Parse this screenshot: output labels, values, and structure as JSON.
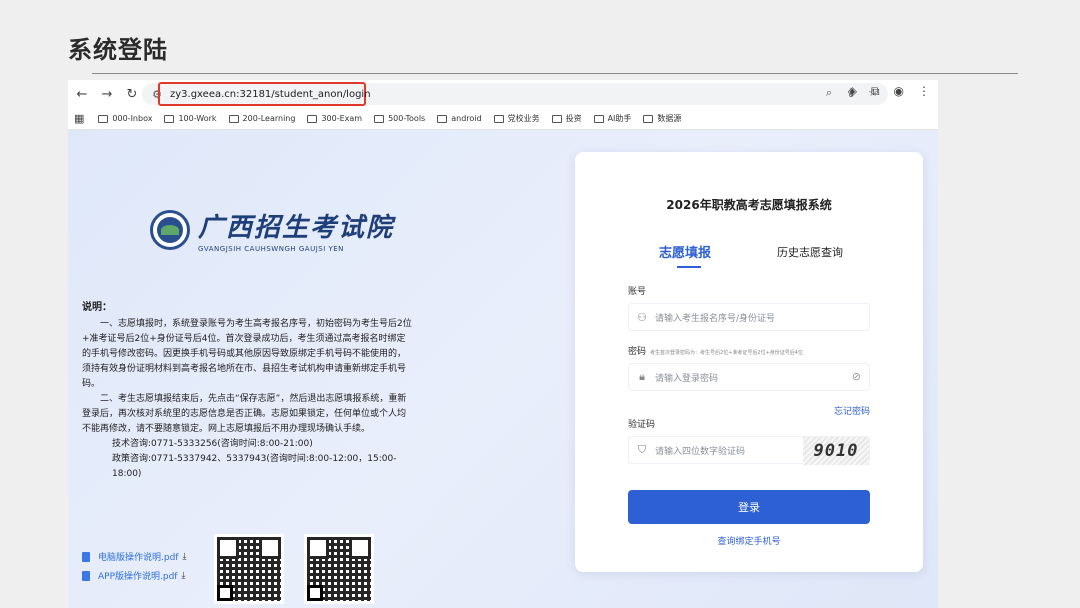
{
  "slide": {
    "title": "系统登陆"
  },
  "browser": {
    "url": "zy3.gxeea.cn:32181/student_anon/login",
    "bookmarks": [
      "000-Inbox",
      "100-Work",
      "200-Learning",
      "300-Exam",
      "500-Tools",
      "android",
      "党校业务",
      "投资",
      "AI助手",
      "数据源"
    ]
  },
  "left": {
    "logo_cn": "广西招生考试院",
    "logo_en": "GVANGJSIH CAUHSWNGH GAUJSI YEN",
    "notes_head": "说明：",
    "note1": "一、志愿填报时，系统登录账号为考生高考报名序号，初始密码为考生号后2位+准考证号后2位+身份证号后4位。首次登录成功后，考生须通过高考报名时绑定的手机号修改密码。因更换手机号码或其他原因导致原绑定手机号码不能使用的，须持有效身份证明材料到高考报名地所在市、县招生考试机构申请重新绑定手机号码。",
    "note2": "二、考生志愿填报结束后，先点击“保存志愿”，然后退出志愿填报系统，重新登录后，再次核对系统里的志愿信息是否正确。志愿如果锁定，任何单位或个人均不能再修改，请不要随意锁定。网上志愿填报后不用办理现场确认手续。",
    "tech": "技术咨询:0771-5333256(咨询时间:8:00-21:00)",
    "policy": "政策咨询:0771-5337942、5337943(咨询时间:8:00-12:00，15:00-18:00)",
    "pdf1": "电脑版操作说明.pdf",
    "pdf2": "APP版操作说明.pdf"
  },
  "login": {
    "title": "2026年职教高考志愿填报系统",
    "tab_active": "志愿填报",
    "tab_other": "历史志愿查询",
    "account_label": "账号",
    "account_placeholder": "请输入考生报名序号/身份证号",
    "password_label": "密码",
    "password_hint": "考生首次登录密码为：考生号后2位+准考证号后2位+身份证号后4位",
    "password_placeholder": "请输入登录密码",
    "forgot": "忘记密码",
    "captcha_label": "验证码",
    "captcha_placeholder": "请输入四位数字验证码",
    "captcha_value": "9010",
    "login_button": "登录",
    "query_phone": "查询绑定手机号"
  }
}
